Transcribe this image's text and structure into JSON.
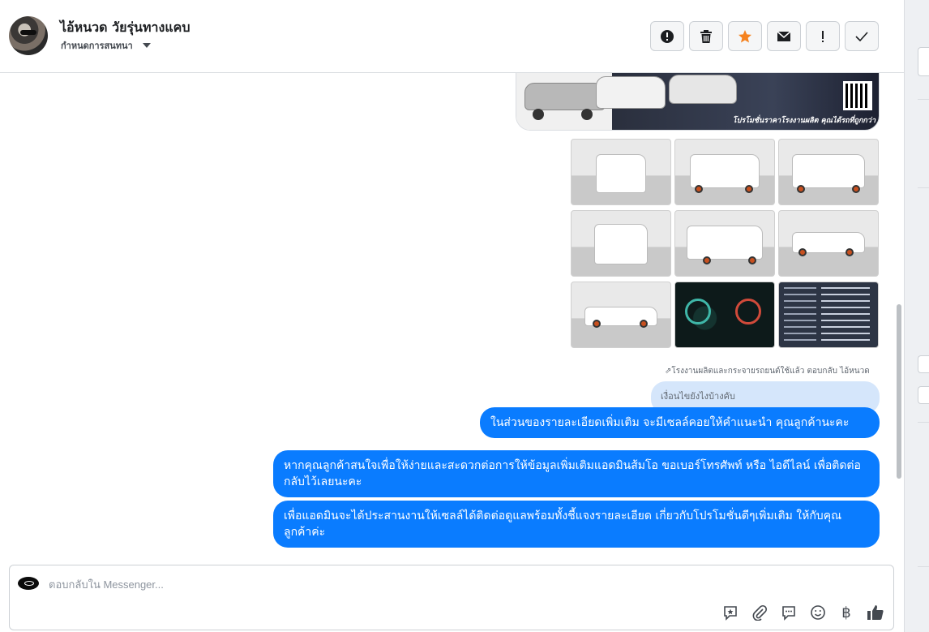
{
  "conversation": {
    "contact_name": "ไอ้หนวด วัยรุ่นทางแคบ",
    "assign_label": "กำหนดการสนทนา"
  },
  "header_actions": [
    {
      "name": "report-spam-button",
      "icon": "alert-circle-icon"
    },
    {
      "name": "delete-button",
      "icon": "trash-icon"
    },
    {
      "name": "star-button",
      "icon": "star-icon",
      "color": "#f5821f"
    },
    {
      "name": "mark-unread-button",
      "icon": "envelope-icon"
    },
    {
      "name": "mark-important-button",
      "icon": "exclamation-icon"
    },
    {
      "name": "mark-done-button",
      "icon": "check-icon"
    }
  ],
  "messages": {
    "banner_caption": "โปรโมชั่นราคาโรงงานผลิต คุณได้รถที่ถูกกว่า",
    "reply_meta": "โรงงานผลิตและกระจายรถยนต์ใช้แล้ว ตอบกลับ ไอ้หนวด",
    "quoted_text": "เงื่อนไขยังไงบ้างคับ",
    "bubble_1": "ในส่วนของรายละเอียดเพิ่มเติม จะมีเซลล์คอยให้คำแนะนำ คุณลูกค้านะคะ",
    "bubble_2": "หากคุณลูกค้าสนใจเพื่อให้ง่ายและสะดวกต่อการให้ข้อมูลเพิ่มเติมแอดมินส้มโอ ขอเบอร์โทรศัพท์ หรือ ไอดีไลน์ เพื่อติดต่อกลับไว้เลยนะคะ",
    "bubble_3": "เพื่อแอดมินจะได้ประสานงานให้เซลล์ได้ติดต่อดูแลพร้อมทั้งชี้แจงรายละเอียด เกี่ยวกับโปรโมชั่นดีๆเพิ่มเติม ให้กับคุณลูกค้าค่ะ"
  },
  "composer": {
    "placeholder": "ตอบกลับใน Messenger...",
    "tools": [
      "saved-reply-icon",
      "attach-icon",
      "chat-bubble-icon",
      "emoji-icon",
      "baht-icon",
      "thumbs-up-icon"
    ]
  },
  "colors": {
    "brand_blue": "#0a7cff",
    "quoted_bg": "#d5e6fb",
    "star": "#f5821f"
  }
}
